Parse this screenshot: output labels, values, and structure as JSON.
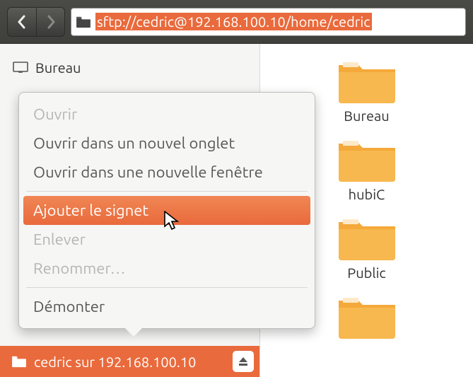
{
  "toolbar": {
    "address": "sftp://cedric@192.168.100.10/home/cedric"
  },
  "sidebar": {
    "desktop_label": "Bureau",
    "mount_label": "cedric sur 192.168.100.10"
  },
  "context_menu": {
    "open": "Ouvrir",
    "open_tab": "Ouvrir dans un nouvel onglet",
    "open_window": "Ouvrir dans une nouvelle fenêtre",
    "bookmark": "Ajouter le signet",
    "remove": "Enlever",
    "rename": "Renommer…",
    "unmount": "Démonter"
  },
  "folders": [
    {
      "label": "Bureau"
    },
    {
      "label": "hubiC"
    },
    {
      "label": "Public"
    },
    {
      "label": ""
    }
  ]
}
